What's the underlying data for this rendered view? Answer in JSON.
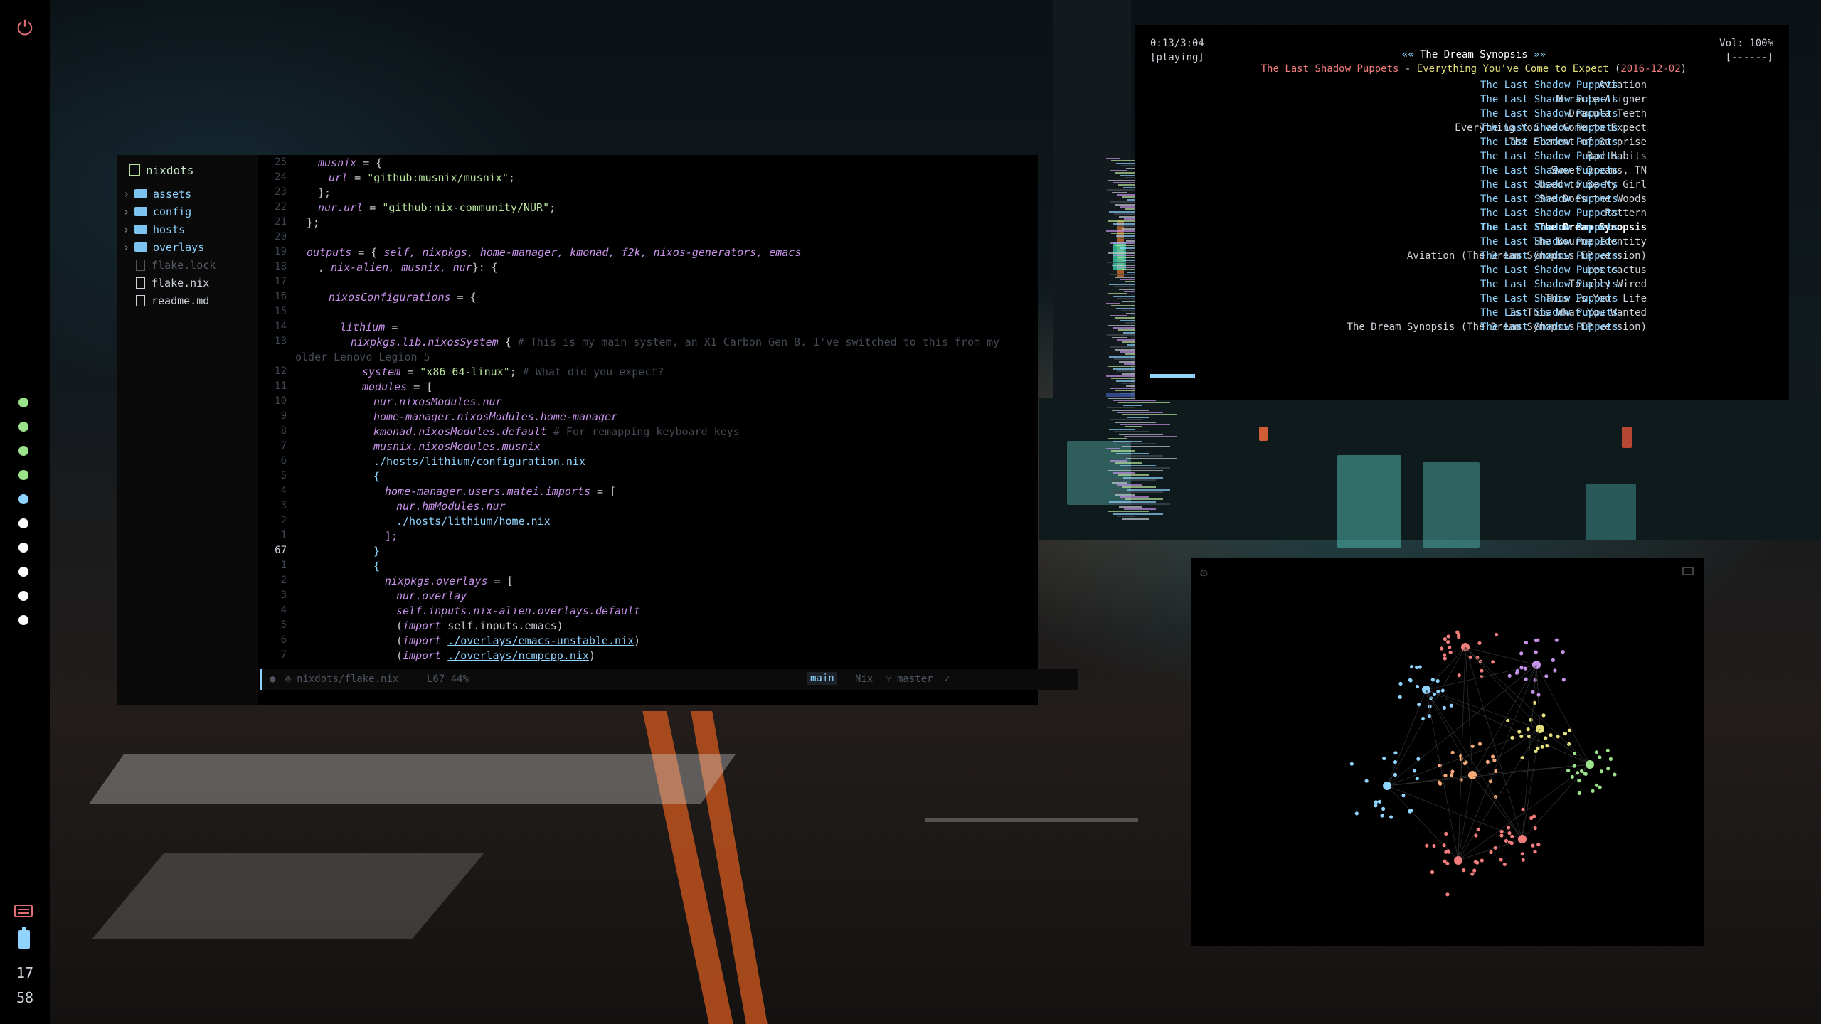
{
  "sidebar": {
    "clock_hour": "17",
    "clock_minute": "58",
    "workspace_colors": [
      "#9be38a",
      "#9be38a",
      "#9be38a",
      "#9be38a",
      "#8fd3ff",
      "#ffffff",
      "#ffffff",
      "#ffffff",
      "#ffffff",
      "#ffffff"
    ]
  },
  "editor": {
    "tree": {
      "title": "nixdots",
      "items": [
        {
          "type": "folder",
          "label": "assets"
        },
        {
          "type": "folder",
          "label": "config"
        },
        {
          "type": "folder",
          "label": "hosts"
        },
        {
          "type": "folder",
          "label": "overlays"
        },
        {
          "type": "file",
          "label": "flake.lock",
          "dim": true
        },
        {
          "type": "file",
          "label": "flake.nix"
        },
        {
          "type": "file",
          "label": "readme.md"
        }
      ]
    },
    "line_numbers": [
      "25",
      "24",
      "23",
      "22",
      "21",
      "20",
      "19",
      "18",
      "17",
      "16",
      "15",
      "14",
      "13",
      "",
      "12",
      "11",
      "10",
      "9",
      "8",
      "7",
      "6",
      "5",
      "4",
      "3",
      "2",
      "1",
      "67",
      "1",
      "2",
      "3",
      "4",
      "5",
      "6",
      "7"
    ],
    "code": {
      "l01a": "musnix",
      "l01b": " = {",
      "l02a": "url",
      "l02b": " = ",
      "l02c": "\"github:musnix/musnix\"",
      "l02d": ";",
      "l03": "};",
      "l04a": "nur.url",
      "l04b": " = ",
      "l04c": "\"github:nix-community/NUR\"",
      "l04d": ";",
      "l05": "};",
      "l07a": "outputs",
      "l07b": " = { ",
      "l07c": "self, nixpkgs, home-manager, kmonad, f2k, nixos-generators, emacs",
      "l08a": ", ",
      "l08b": "nix-alien, musnix, nur",
      "l08c": "}: {",
      "l10a": "nixosConfigurations",
      "l10b": " = {",
      "l12a": "lithium",
      "l12b": " =",
      "l13a": "nixpkgs.lib.nixosSystem",
      "l13b": " { ",
      "l13c": "# This is my main system, an X1 Carbon Gen 8. I've switched to this from my",
      "l14": "older Lenovo Legion 5",
      "l15a": "system",
      "l15b": " = ",
      "l15c": "\"x86_64-linux\"",
      "l15d": "; ",
      "l15e": "# What did you expect?",
      "l16a": "modules",
      "l16b": " = [",
      "l17": "nur.nixosModules.nur",
      "l18": "home-manager.nixosModules.home-manager",
      "l19a": "kmonad.nixosModules.default",
      "l19b": " # For remapping keyboard keys",
      "l20": "musnix.nixosModules.musnix",
      "l21": "./hosts/lithium/configuration.nix",
      "l22": "{",
      "l23a": "home-manager.users.matei.imports",
      "l23b": " = [",
      "l24": "nur.hmModules.nur",
      "l25": "./hosts/lithium/home.nix",
      "l26": "];",
      "l27": "}",
      "l28": "{",
      "l29a": "nixpkgs.overlays",
      "l29b": " = [",
      "l30": "nur.overlay",
      "l31": "self.inputs.nix-alien.overlays.default",
      "l32a": "(",
      "l32b": "import",
      "l32c": " self.inputs.emacs)",
      "l33a": "(",
      "l33b": "import",
      "l33c": " ",
      "l33d": "./overlays/emacs-unstable.nix",
      "l33e": ")",
      "l34a": "(",
      "l34b": "import",
      "l34c": " ",
      "l34d": "./overlays/ncmpcpp.nix",
      "l34e": ")",
      "l35": "]"
    },
    "status": {
      "file": "nixdots/flake.nix",
      "pos": "L67 44%",
      "mode": "main",
      "lang": "Nix",
      "branch": "master"
    }
  },
  "player": {
    "time": "0:13/3:04",
    "state": "[playing]",
    "title_prefix": "«« ",
    "title": "The Dream Synopsis",
    "title_suffix": " »»",
    "artist": "The Last Shadow Puppets",
    "sep": " - ",
    "album": "Everything You've Come to Expect",
    "date_open": " (",
    "date": "2016-12-02",
    "date_close": ")",
    "volume": "Vol: 100%",
    "flags": "[------]",
    "progress": 0.07,
    "tracks": [
      {
        "title": "Aviation",
        "artist": "The Last Shadow Puppets"
      },
      {
        "title": "Miracle Aligner",
        "artist": "The Last Shadow Puppets"
      },
      {
        "title": "Dracula Teeth",
        "artist": "The Last Shadow Puppets"
      },
      {
        "title": "Everything You've Come to Expect",
        "artist": "The Last Shadow Puppets"
      },
      {
        "title": "The Element of Surprise",
        "artist": "The Last Shadow Puppets"
      },
      {
        "title": "Bad Habits",
        "artist": "The Last Shadow Puppets"
      },
      {
        "title": "Sweet Dreams, TN",
        "artist": "The Last Shadow Puppets"
      },
      {
        "title": "Used to Be My Girl",
        "artist": "The Last Shadow Puppets"
      },
      {
        "title": "She Does the Woods",
        "artist": "The Last Shadow Puppets"
      },
      {
        "title": "Pattern",
        "artist": "The Last Shadow Puppets"
      },
      {
        "title": "The Dream Synopsis",
        "artist": "The Last Shadow Puppets",
        "current": true
      },
      {
        "title": "The Bourne Identity",
        "artist": "The Last Shadow Puppets"
      },
      {
        "title": "Aviation (The Dream Synopsis EP version)",
        "artist": "The Last Shadow Puppets"
      },
      {
        "title": "Les cactus",
        "artist": "The Last Shadow Puppets"
      },
      {
        "title": "Totally Wired",
        "artist": "The Last Shadow Puppets"
      },
      {
        "title": "This Is Your Life",
        "artist": "The Last Shadow Puppets"
      },
      {
        "title": "Is This What You Wanted",
        "artist": "The Last Shadow Puppets"
      },
      {
        "title": "The Dream Synopsis (The Dream Synopsis EP version)",
        "artist": "The Last Shadow Puppets"
      }
    ]
  },
  "graph": {
    "cluster_colors": [
      "#f07c7c",
      "#c792ea",
      "#8fd3ff",
      "#e5e07b",
      "#f7a97a",
      "#9be38a",
      "#8fd3ff",
      "#f07c7c"
    ]
  }
}
